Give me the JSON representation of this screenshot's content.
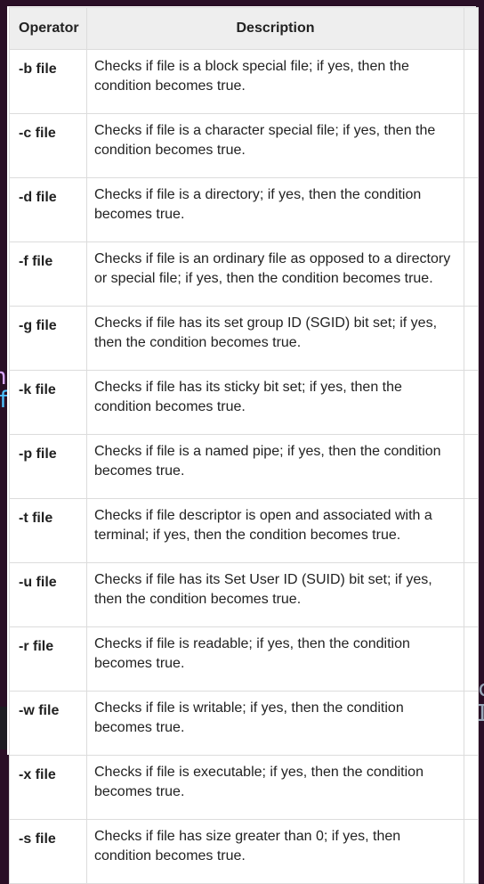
{
  "table": {
    "headers": {
      "operator": "Operator",
      "description": "Description"
    },
    "rows": [
      {
        "operator": "-b file",
        "description": "Checks if file is a block special file; if yes, then the condition becomes true."
      },
      {
        "operator": "-c file",
        "description": "Checks if file is a character special file; if yes, then the condition becomes true."
      },
      {
        "operator": "-d file",
        "description": "Checks if file is a directory; if yes, then the condition becomes true."
      },
      {
        "operator": "-f file",
        "description": "Checks if file is an ordinary file as opposed to a directory or special file; if yes, then the condition becomes true."
      },
      {
        "operator": "-g file",
        "description": "Checks if file has its set group ID (SGID) bit set; if yes, then the condition becomes true."
      },
      {
        "operator": "-k file",
        "description": "Checks if file has its sticky bit set; if yes, then the condition becomes true."
      },
      {
        "operator": "-p file",
        "description": "Checks if file is a named pipe; if yes, then the condition becomes true."
      },
      {
        "operator": "-t file",
        "description": "Checks if file descriptor is open and associated with a terminal; if yes, then the condition becomes true."
      },
      {
        "operator": "-u file",
        "description": "Checks if file has its Set User ID (SUID) bit set; if yes, then the condition becomes true."
      },
      {
        "operator": "-r file",
        "description": "Checks if file is readable; if yes, then the condition becomes true."
      },
      {
        "operator": "-w file",
        "description": "Checks if file is writable; if yes, then the condition becomes true."
      },
      {
        "operator": "-x file",
        "description": "Checks if file is executable; if yes, then the condition becomes true."
      },
      {
        "operator": "-s file",
        "description": "Checks if file has size greater than 0; if yes, then condition becomes true."
      }
    ]
  },
  "background": {
    "left_fragment_top": "n",
    "left_fragment_bottom": "f",
    "right_fragment_top": "c",
    "right_fragment_bottom": "I"
  },
  "colors": {
    "background": "#2a0f26",
    "table_header_bg": "#eeeeee",
    "table_border": "#dcdcdc",
    "text": "#222222"
  }
}
